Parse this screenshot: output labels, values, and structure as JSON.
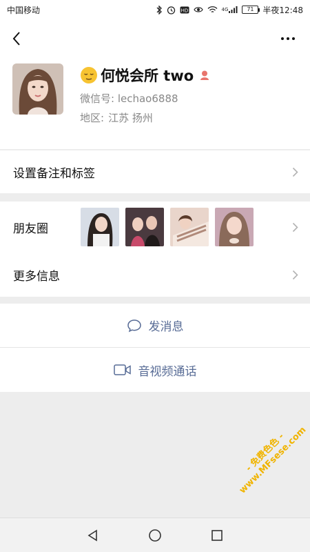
{
  "status_bar": {
    "carrier": "中国移动",
    "network": "4G",
    "battery": "71",
    "time": "半夜12:48"
  },
  "profile": {
    "name": "何悦会所 two",
    "wechat_id_label": "微信号:",
    "wechat_id": "lechao6888",
    "region_label": "地区:",
    "region": "江苏  扬州"
  },
  "rows": {
    "tags_label": "设置备注和标签",
    "moments_label": "朋友圈",
    "more_label": "更多信息"
  },
  "actions": {
    "message_label": "发消息",
    "call_label": "音视频通话"
  },
  "watermark": {
    "line1": "- 免费色色 -",
    "line2": "www.MFsese.com"
  },
  "colors": {
    "link": "#576b95",
    "background": "#ededed",
    "gender_icon": "#e8746c",
    "watermark": "#f0b400"
  }
}
